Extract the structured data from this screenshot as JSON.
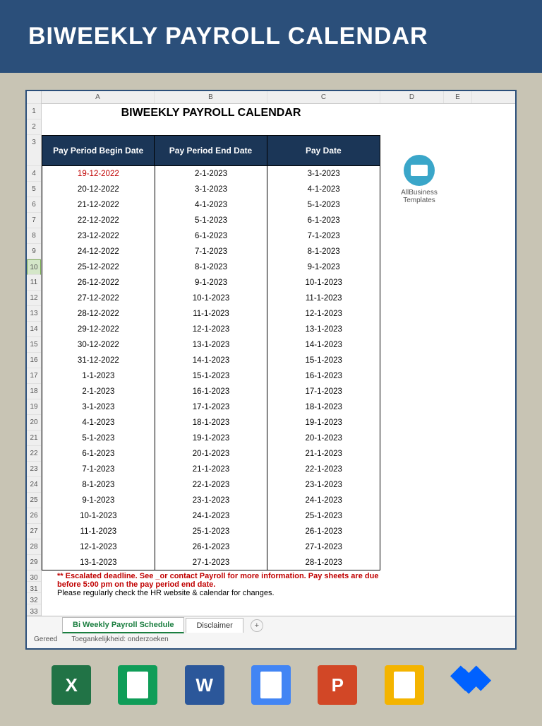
{
  "banner": {
    "title": "BIWEEKLY PAYROLL CALENDAR"
  },
  "sheet": {
    "title": "BIWEEKLY PAYROLL CALENDAR",
    "columns": [
      "A",
      "B",
      "C",
      "D",
      "E"
    ],
    "headers": {
      "begin": "Pay Period Begin Date",
      "end": "Pay Period End Date",
      "pay": "Pay Date"
    },
    "brand": {
      "line1": "AllBusiness",
      "line2": "Templates"
    },
    "rows": [
      {
        "n": 4,
        "begin": "19-12-2022",
        "end": "2-1-2023",
        "pay": "3-1-2023",
        "first": true
      },
      {
        "n": 5,
        "begin": "20-12-2022",
        "end": "3-1-2023",
        "pay": "4-1-2023"
      },
      {
        "n": 6,
        "begin": "21-12-2022",
        "end": "4-1-2023",
        "pay": "5-1-2023"
      },
      {
        "n": 7,
        "begin": "22-12-2022",
        "end": "5-1-2023",
        "pay": "6-1-2023"
      },
      {
        "n": 8,
        "begin": "23-12-2022",
        "end": "6-1-2023",
        "pay": "7-1-2023"
      },
      {
        "n": 9,
        "begin": "24-12-2022",
        "end": "7-1-2023",
        "pay": "8-1-2023"
      },
      {
        "n": 10,
        "begin": "25-12-2022",
        "end": "8-1-2023",
        "pay": "9-1-2023",
        "selected": true
      },
      {
        "n": 11,
        "begin": "26-12-2022",
        "end": "9-1-2023",
        "pay": "10-1-2023"
      },
      {
        "n": 12,
        "begin": "27-12-2022",
        "end": "10-1-2023",
        "pay": "11-1-2023"
      },
      {
        "n": 13,
        "begin": "28-12-2022",
        "end": "11-1-2023",
        "pay": "12-1-2023"
      },
      {
        "n": 14,
        "begin": "29-12-2022",
        "end": "12-1-2023",
        "pay": "13-1-2023"
      },
      {
        "n": 15,
        "begin": "30-12-2022",
        "end": "13-1-2023",
        "pay": "14-1-2023"
      },
      {
        "n": 16,
        "begin": "31-12-2022",
        "end": "14-1-2023",
        "pay": "15-1-2023"
      },
      {
        "n": 17,
        "begin": "1-1-2023",
        "end": "15-1-2023",
        "pay": "16-1-2023"
      },
      {
        "n": 18,
        "begin": "2-1-2023",
        "end": "16-1-2023",
        "pay": "17-1-2023"
      },
      {
        "n": 19,
        "begin": "3-1-2023",
        "end": "17-1-2023",
        "pay": "18-1-2023"
      },
      {
        "n": 20,
        "begin": "4-1-2023",
        "end": "18-1-2023",
        "pay": "19-1-2023"
      },
      {
        "n": 21,
        "begin": "5-1-2023",
        "end": "19-1-2023",
        "pay": "20-1-2023"
      },
      {
        "n": 22,
        "begin": "6-1-2023",
        "end": "20-1-2023",
        "pay": "21-1-2023"
      },
      {
        "n": 23,
        "begin": "7-1-2023",
        "end": "21-1-2023",
        "pay": "22-1-2023"
      },
      {
        "n": 24,
        "begin": "8-1-2023",
        "end": "22-1-2023",
        "pay": "23-1-2023"
      },
      {
        "n": 25,
        "begin": "9-1-2023",
        "end": "23-1-2023",
        "pay": "24-1-2023"
      },
      {
        "n": 26,
        "begin": "10-1-2023",
        "end": "24-1-2023",
        "pay": "25-1-2023"
      },
      {
        "n": 27,
        "begin": "11-1-2023",
        "end": "25-1-2023",
        "pay": "26-1-2023"
      },
      {
        "n": 28,
        "begin": "12-1-2023",
        "end": "26-1-2023",
        "pay": "27-1-2023"
      },
      {
        "n": 29,
        "begin": "13-1-2023",
        "end": "27-1-2023",
        "pay": "28-1-2023"
      }
    ],
    "post_rows": [
      "30",
      "31",
      "32",
      "33"
    ],
    "note_red": "** Escalated deadline. See _or contact Payroll for more information. Pay sheets are due",
    "note_red2": "before 5:00 pm on the pay period end date.",
    "note_plain": "Please regularly check the HR website & calendar for changes."
  },
  "tabs": {
    "active": "Bi Weekly Payroll Schedule",
    "other": "Disclaimer",
    "plus": "+"
  },
  "status": {
    "ready": "Gereed",
    "access": "Toegankelijkheid: onderzoeken"
  },
  "apps": [
    "excel",
    "sheets",
    "word",
    "docs",
    "ppt",
    "slides",
    "dropbox"
  ]
}
